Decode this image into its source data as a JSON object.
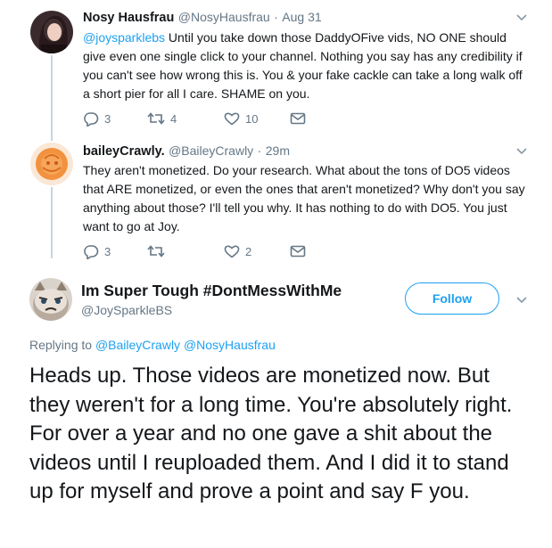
{
  "tweet1": {
    "name": "Nosy Hausfrau",
    "handle": "@NosyHausfrau",
    "separator": "·",
    "time": "Aug 31",
    "mention": "@joysparklebs",
    "body": " Until you take down those DaddyOFive vids, NO ONE should give even one single click to your channel. Nothing you say has any credibility if you can't see how wrong this is. You & your fake cackle can take a long walk off a short pier for all I care. SHAME on you.",
    "replies": "3",
    "retweets": "4",
    "likes": "10"
  },
  "tweet2": {
    "name": "baileyCrawly.",
    "handle": "@BaileyCrawly",
    "separator": "·",
    "time": "29m",
    "body": "They aren't monetized. Do your research. What about the tons of DO5 videos that ARE monetized, or even the ones that aren't monetized? Why don't you say anything about those? I'll tell you why. It has nothing to do with DO5. You just want to go at Joy.",
    "replies": "3",
    "retweets": "",
    "likes": "2"
  },
  "main": {
    "name": "Im Super Tough #DontMessWithMe",
    "handle": "@JoySparkleBS",
    "follow_label": "Follow",
    "replying_prefix": "Replying to ",
    "replying_to_1": "@BaileyCrawly",
    "replying_to_2": "@NosyHausfrau",
    "body": "Heads up. Those videos are monetized now. But they weren't for a long time. You're absolutely right. For over a year and no one gave a shit about the videos until I reuploaded them. And I did it to stand up for myself and prove a point and say F you."
  },
  "colors": {
    "accent": "#1da1f2",
    "muted": "#657786",
    "thread_line": "#c9d5e0"
  }
}
